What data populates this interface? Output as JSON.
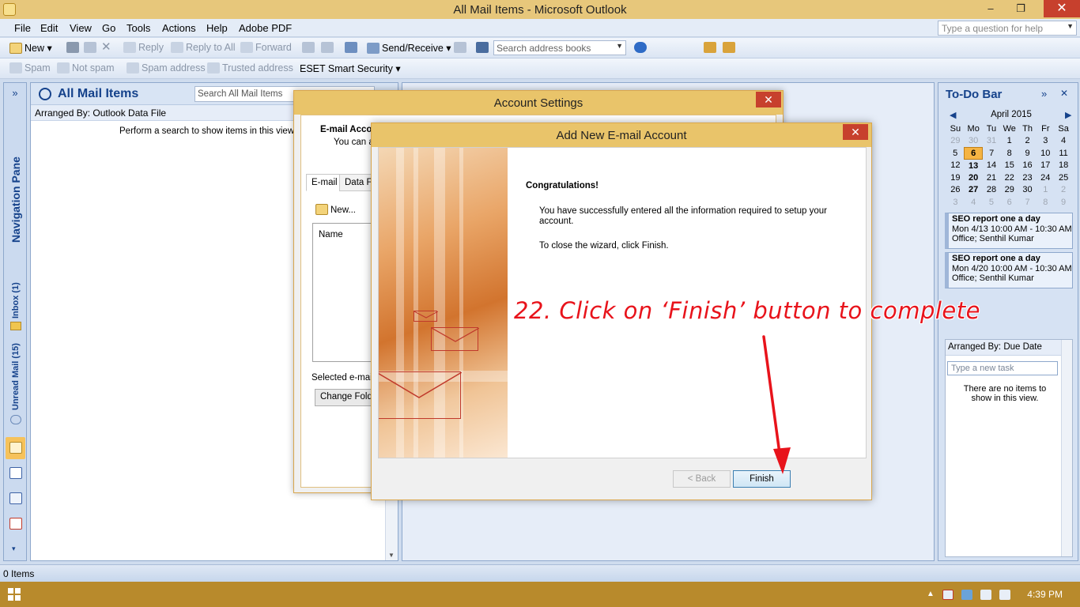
{
  "window": {
    "title": "All Mail Items - Microsoft Outlook",
    "minimize": "–",
    "restore": "❐",
    "close": "✕"
  },
  "menu": {
    "items": [
      "File",
      "Edit",
      "View",
      "Go",
      "Tools",
      "Actions",
      "Help",
      "Adobe PDF"
    ],
    "help_placeholder": "Type a question for help"
  },
  "toolbar1": {
    "new": "New",
    "reply": "Reply",
    "reply_all": "Reply to All",
    "forward": "Forward",
    "send_receive": "Send/Receive",
    "search_address_books": "Search address books"
  },
  "toolbar2": {
    "spam": "Spam",
    "not_spam": "Not spam",
    "spam_address": "Spam address",
    "trusted_address": "Trusted address",
    "eset": "ESET Smart Security"
  },
  "navpane": {
    "expand": "»",
    "label": "Navigation Pane",
    "inbox": "Inbox (1)",
    "unread": "Unread Mail (15)"
  },
  "mail": {
    "title": "All Mail Items",
    "search_placeholder": "Search All Mail Items",
    "arranged_by": "Arranged By: Outlook Data File",
    "empty_msg": "Perform a search to show items in this view."
  },
  "todo": {
    "title": "To-Do Bar",
    "expand": "»",
    "close": "✕",
    "calendar": {
      "month": "April 2015",
      "weekdays": [
        "Su",
        "Mo",
        "Tu",
        "We",
        "Th",
        "Fr",
        "Sa"
      ],
      "weeks": [
        [
          "29",
          "30",
          "31",
          "1",
          "2",
          "3",
          "4"
        ],
        [
          "5",
          "6",
          "7",
          "8",
          "9",
          "10",
          "11"
        ],
        [
          "12",
          "13",
          "14",
          "15",
          "16",
          "17",
          "18"
        ],
        [
          "19",
          "20",
          "21",
          "22",
          "23",
          "24",
          "25"
        ],
        [
          "26",
          "27",
          "28",
          "29",
          "30",
          "1",
          "2"
        ],
        [
          "3",
          "4",
          "5",
          "6",
          "7",
          "8",
          "9"
        ]
      ],
      "today": "6"
    },
    "appointments": [
      {
        "subject": "SEO report one a day",
        "time": "Mon 4/13 10:00 AM - 10:30 AM",
        "location": "Office; Senthil Kumar"
      },
      {
        "subject": "SEO report one a day",
        "time": "Mon 4/20 10:00 AM - 10:30 AM",
        "location": "Office; Senthil Kumar"
      }
    ],
    "tasks_arranged": "Arranged By: Due Date",
    "new_task_placeholder": "Type a new task",
    "no_items": "There are no items to show in this view."
  },
  "status": {
    "items": "0 Items"
  },
  "taskbar": {
    "time": "4:39 PM"
  },
  "account_settings": {
    "title": "Account Settings",
    "header_title": "E-mail Acco",
    "header_sub": "You can a",
    "tab_email": "E-mail",
    "tab_data": "Data Fi",
    "new_btn": "New...",
    "col_name": "Name",
    "selected_label": "Selected e-mail",
    "change_folder": "Change Folde"
  },
  "add_account": {
    "title": "Add New E-mail Account",
    "congrats": "Congratulations!",
    "message": "You have successfully entered all the information required to setup your account.",
    "close_hint": "To close the wizard, click Finish.",
    "back": "< Back",
    "finish": "Finish"
  },
  "annotation": {
    "text": "22. Click on ‘Finish’ button to complete",
    "color": "#e8131b"
  }
}
